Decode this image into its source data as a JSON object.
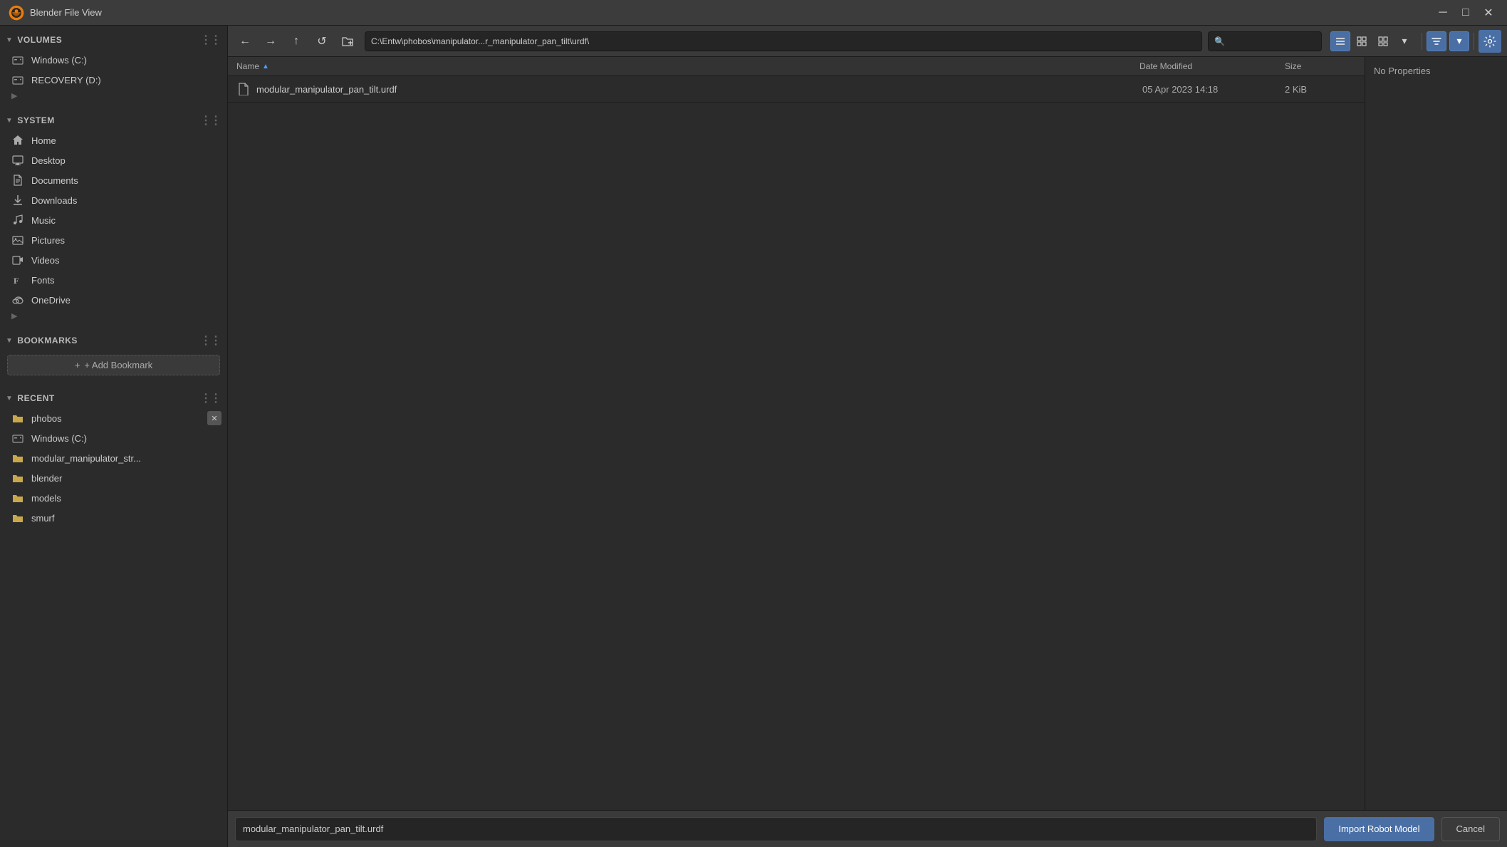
{
  "titleBar": {
    "title": "Blender File View",
    "minButton": "─",
    "maxButton": "□",
    "closeButton": "✕"
  },
  "toolbar": {
    "backBtn": "←",
    "forwardBtn": "→",
    "upBtn": "↑",
    "refreshBtn": "↺",
    "newFolderBtn": "📁",
    "pathValue": "C:\\Entw\\phobos\\manipulator...r_manipulator_pan_tilt\\urdf\\",
    "searchPlaceholder": "🔍"
  },
  "sidebar": {
    "sections": {
      "volumes": {
        "label": "Volumes",
        "items": [
          {
            "name": "Windows (C:)",
            "icon": "drive"
          },
          {
            "name": "RECOVERY (D:)",
            "icon": "drive"
          }
        ]
      },
      "system": {
        "label": "System",
        "items": [
          {
            "name": "Home",
            "icon": "home"
          },
          {
            "name": "Desktop",
            "icon": "desktop"
          },
          {
            "name": "Documents",
            "icon": "documents"
          },
          {
            "name": "Downloads",
            "icon": "downloads"
          },
          {
            "name": "Music",
            "icon": "music"
          },
          {
            "name": "Pictures",
            "icon": "pictures"
          },
          {
            "name": "Videos",
            "icon": "videos"
          },
          {
            "name": "Fonts",
            "icon": "fonts"
          },
          {
            "name": "OneDrive",
            "icon": "onedrive"
          }
        ]
      },
      "bookmarks": {
        "label": "Bookmarks",
        "addLabel": "+ Add Bookmark"
      },
      "recent": {
        "label": "Recent",
        "items": [
          {
            "name": "phobos",
            "icon": "folder",
            "hasClose": true
          },
          {
            "name": "Windows (C:)",
            "icon": "drive",
            "hasClose": false
          },
          {
            "name": "modular_manipulator_str...",
            "icon": "folder",
            "hasClose": false
          },
          {
            "name": "blender",
            "icon": "folder",
            "hasClose": false
          },
          {
            "name": "models",
            "icon": "folder",
            "hasClose": false
          },
          {
            "name": "smurf",
            "icon": "folder",
            "hasClose": false
          }
        ]
      }
    }
  },
  "fileList": {
    "columns": {
      "name": "Name",
      "dateModified": "Date Modified",
      "size": "Size"
    },
    "files": [
      {
        "name": "modular_manipulator_pan_tilt.urdf",
        "dateModified": "05 Apr 2023 14:18",
        "size": "2 KiB",
        "icon": "file"
      }
    ]
  },
  "propertiesPanel": {
    "label": "No Properties"
  },
  "bottomBar": {
    "filenameValue": "modular_manipulator_pan_tilt.urdf",
    "importLabel": "Import Robot Model",
    "cancelLabel": "Cancel"
  }
}
